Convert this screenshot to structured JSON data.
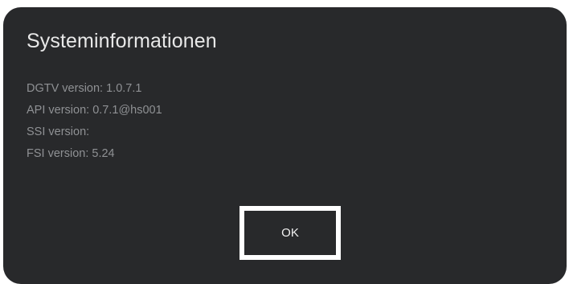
{
  "dialog": {
    "title": "Systeminformationen",
    "info_lines": [
      "DGTV version: 1.0.7.1",
      "API version: 0.7.1@hs001",
      "SSI version:",
      "FSI version: 5.24"
    ],
    "ok_label": "OK"
  },
  "colors": {
    "dialog_background": "#28292b",
    "title_text": "#e8e8e8",
    "info_text": "#8f9194",
    "button_border": "#ffffff"
  }
}
